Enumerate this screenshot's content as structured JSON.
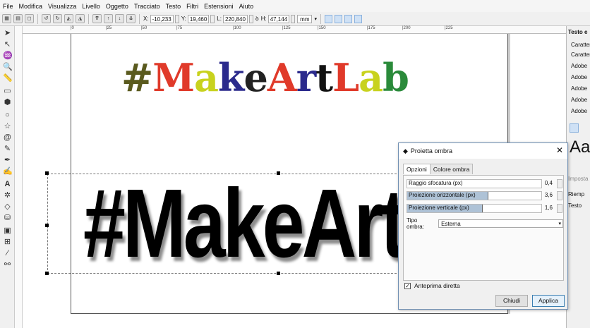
{
  "menu": [
    "File",
    "Modifica",
    "Visualizza",
    "Livello",
    "Oggetto",
    "Tracciato",
    "Testo",
    "Filtri",
    "Estensioni",
    "Aiuto"
  ],
  "toolbar": {
    "x_label": "X:",
    "x_value": "-10,233",
    "y_label": "Y:",
    "y_value": "19,460",
    "w_label": "L:",
    "w_value": "220,840",
    "h_label": "H:",
    "h_value": "47,144",
    "unit": "mm"
  },
  "ruler": {
    "ticks": [
      "|0",
      "|25",
      "|50",
      "|75",
      "|100",
      "|125",
      "|150",
      "|175",
      "|200",
      "|225"
    ]
  },
  "canvas": {
    "logo_parts": [
      {
        "text": "#",
        "color": "#5a5a1e"
      },
      {
        "text": "M",
        "color": "#e03a2a"
      },
      {
        "text": "a",
        "color": "#c8d21e"
      },
      {
        "text": "k",
        "color": "#2b2a8c"
      },
      {
        "text": "e",
        "color": "#222222"
      },
      {
        "text": "A",
        "color": "#e03a2a"
      },
      {
        "text": "r",
        "color": "#2b2a8c"
      },
      {
        "text": "t",
        "color": "#111111"
      },
      {
        "text": "L",
        "color": "#e03a2a"
      },
      {
        "text": "a",
        "color": "#c8d21e"
      },
      {
        "text": "b",
        "color": "#2a8a3a"
      }
    ],
    "big_text": "#MakeArtL"
  },
  "right_panel": {
    "title": "Testo e",
    "items": [
      "Caratter",
      "Caratter",
      "Adobe",
      "Adobe",
      "Adobe",
      "Adobe",
      "Adobe"
    ],
    "preview": "Aa",
    "imposta": "Imposta",
    "riemp": "Riemp",
    "testo": "Testo"
  },
  "dialog": {
    "title": "Proietta ombra",
    "tabs": [
      "Opzioni",
      "Colore ombra"
    ],
    "sliders": [
      {
        "label": "Raggio sfocatura (px)",
        "value": "0,4",
        "fraction": 0.0
      },
      {
        "label": "Proiezione orizzontale (px)",
        "value": "3,6",
        "fraction": 0.6
      },
      {
        "label": "Proiezione verticale (px)",
        "value": "1,6",
        "fraction": 0.56
      }
    ],
    "tipo_label": "Tipo ombra:",
    "tipo_value": "Esterna",
    "preview_label": "Anteprima diretta",
    "close_label": "Chiudi",
    "apply_label": "Applica"
  }
}
